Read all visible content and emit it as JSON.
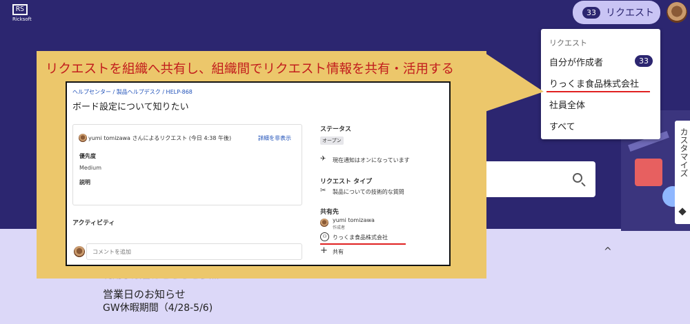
{
  "header": {
    "logo_mark": "RS",
    "logo_text": "Ricksoft",
    "requests_count": "33",
    "requests_label": "リクエスト"
  },
  "dropdown": {
    "heading": "リクエスト",
    "items": [
      {
        "label": "自分が作成者",
        "count": "33"
      },
      {
        "label": "りっくま食品株式会社"
      },
      {
        "label": "社員全体"
      },
      {
        "label": "すべて"
      }
    ]
  },
  "customize_tab": "カスタマイズ",
  "page": {
    "ghost_text": "利用手順書はこちらを参照",
    "notice_title": "営業日のお知らせ",
    "notice_item": "GW休暇期間（4/28-5/6)"
  },
  "callout": {
    "title": "リクエストを組織へ共有し、組織間でリクエスト情報を共有・活用する",
    "breadcrumb": "ヘルプセンター  /  製品ヘルプデスク  /  HELP-868",
    "ticket_title": "ボード設定について知りたい",
    "request_by": "yumi tomizawa さんによるリクエスト (今日 4:38 午後)",
    "hide_details": "詳細を非表示",
    "priority_label": "優先度",
    "priority_value": "Medium",
    "description_label": "説明",
    "activity_label": "アクティビティ",
    "comment_placeholder": "コメントを追加",
    "status_label": "ステータス",
    "status_value": "オープン",
    "notification": "現在通知はオンになっています",
    "request_type_label": "リクエスト タイプ",
    "request_type_value": "製品についての技術的な質問",
    "shared_label": "共有先",
    "shared_user": "yumi tomizawa",
    "shared_user_role": "作成者",
    "shared_org": "りっくま食品株式会社",
    "share_action": "共有"
  },
  "colors": {
    "header_bg": "#2c2670",
    "callout_bg": "#ecc76b",
    "callout_title": "#c21d1d",
    "highlight_line": "#e02020"
  }
}
